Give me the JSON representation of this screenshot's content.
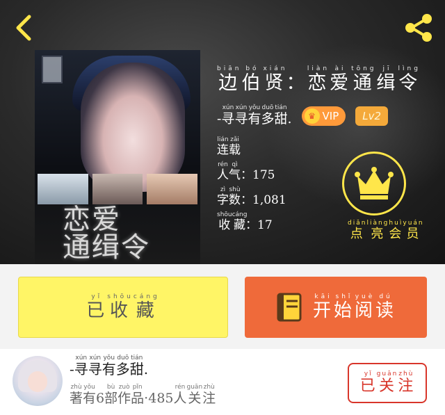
{
  "colors": {
    "accent_yellow": "#ffe64a",
    "collect_button": "#fff566",
    "read_button": "#ef6a3a",
    "follow_red": "#d8352a",
    "vip_orange": "#ff9a3a",
    "lv_orange": "#f4a93a"
  },
  "header": {
    "back_icon": "chevron-left-icon",
    "share_icon": "share-icon"
  },
  "book": {
    "title": "边伯贤：恋爱通缉令",
    "title_pinyin": [
      "biān",
      "bó",
      "xián",
      "",
      "liàn",
      "ài",
      "tōng",
      "jī",
      "lìng"
    ],
    "cover_title_line1": "恋爱",
    "cover_title_line2": "通缉令",
    "author": "-寻寻有多甜.",
    "author_pinyin": [
      "",
      "xún",
      "xún",
      "yǒu",
      "duō",
      "tián",
      ""
    ],
    "vip_label": "VIP",
    "level_label": "Lv2",
    "status": "连载",
    "status_pinyin": [
      "lián",
      "zǎi"
    ],
    "popularity_label": "人气：",
    "popularity_pinyin": [
      "rén",
      "qì"
    ],
    "popularity": "175",
    "words_label": "字数：",
    "words_pinyin": [
      "zì",
      "shù"
    ],
    "words": "1,081",
    "favorites_label": "收藏：",
    "favorites_pinyin": [
      "shōu",
      "cáng"
    ],
    "favorites": "17"
  },
  "member": {
    "icon": "crown-icon",
    "label": "点亮会员",
    "label_pinyin": [
      "diǎn",
      "liàng",
      "huì",
      "yuán"
    ]
  },
  "actions": {
    "collect_label": "已收藏",
    "collect_pinyin": [
      "yǐ",
      "shōu",
      "cáng"
    ],
    "read_label": "开始阅读",
    "read_pinyin": [
      "kāi",
      "shǐ",
      "yuè",
      "dú"
    ],
    "read_icon": "book-icon"
  },
  "author_bar": {
    "name": "-寻寻有多甜.",
    "name_pinyin": [
      "",
      "xún",
      "xún",
      "yǒu",
      "duō",
      "tián",
      ""
    ],
    "stats": "著有6部作品·485人关注",
    "stats_pinyin": [
      "zhù",
      "yǒu",
      "",
      "bù",
      "zuò",
      "pǐn",
      "",
      "",
      "",
      "",
      "rén",
      "guān",
      "zhù"
    ],
    "follow_label": "已关注",
    "follow_pinyin": [
      "yǐ",
      "guān",
      "zhù"
    ]
  }
}
